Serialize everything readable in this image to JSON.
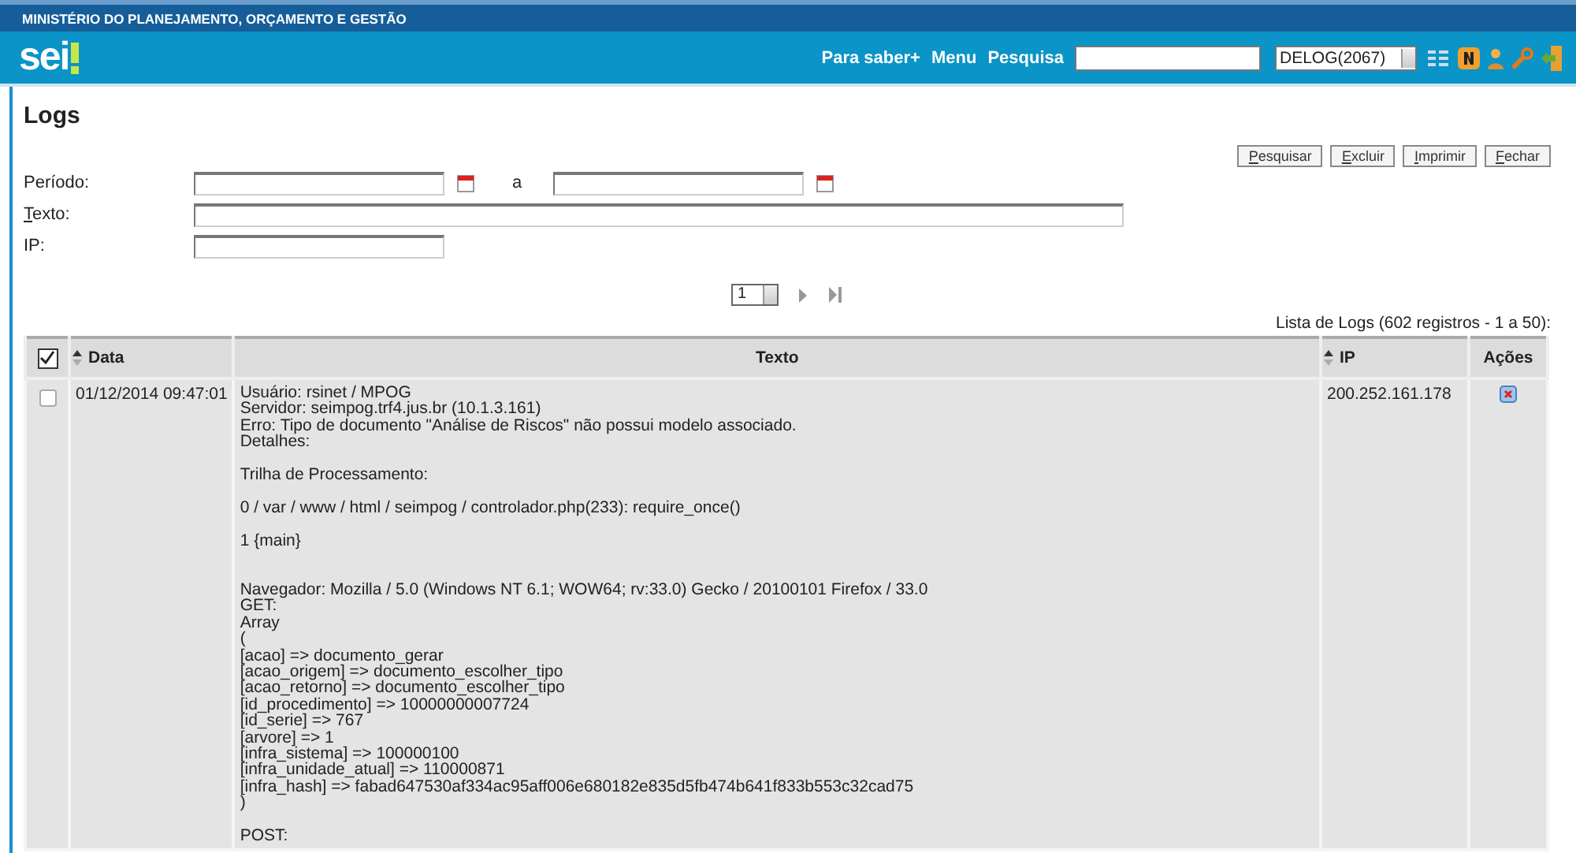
{
  "top_bar": {
    "title": "MINISTÉRIO DO PLANEJAMENTO, ORÇAMENTO E GESTÃO"
  },
  "header": {
    "logo": "sei",
    "links": [
      "Para saber+",
      "Menu",
      "Pesquisa"
    ],
    "unit_select": "DELOG(2067)"
  },
  "page": {
    "title": "Logs"
  },
  "buttons": [
    "Pesquisar",
    "Excluir",
    "Imprimir",
    "Fechar"
  ],
  "filters": {
    "period_label": "Período:",
    "period_separator": "a",
    "text_label": "Texto:",
    "ip_label": "IP:"
  },
  "pagination": {
    "page": "1"
  },
  "table": {
    "caption": "Lista de Logs (602 registros - 1 a 50):",
    "select_all": {
      "checked": true
    },
    "columns": [
      {
        "label": "Data",
        "sortable": true
      },
      {
        "label": "Texto",
        "sortable": false
      },
      {
        "label": "IP",
        "sortable": true
      },
      {
        "label": "Ações",
        "sortable": false
      }
    ],
    "rows": [
      {
        "checked": false,
        "date": "01/12/2014 09:47:01",
        "ip": "200.252.161.178",
        "text": "Usuário: rsinet / MPOG\nServidor: seimpog.trf4.jus.br (10.1.3.161)\nErro: Tipo de documento \"Análise de Riscos\" não possui modelo associado.\nDetalhes:\n\nTrilha de Processamento:\n\n0 / var / www / html / seimpog / controlador.php(233): require_once()\n\n1 {main}\n\n\nNavegador: Mozilla / 5.0 (Windows NT 6.1; WOW64; rv:33.0) Gecko / 20100101 Firefox / 33.0\nGET:\nArray\n(\n[acao] => documento_gerar\n[acao_origem] => documento_escolher_tipo\n[acao_retorno] => documento_escolher_tipo\n[id_procedimento] => 10000000007724\n[id_serie] => 767\n[arvore] => 1\n[infra_sistema] => 100000100\n[infra_unidade_atual] => 110000871\n[infra_hash] => fabad647530af334ac95aff006e680182e835d5fb474b641f833b553c32cad75\n)\n\nPOST:"
      }
    ]
  }
}
